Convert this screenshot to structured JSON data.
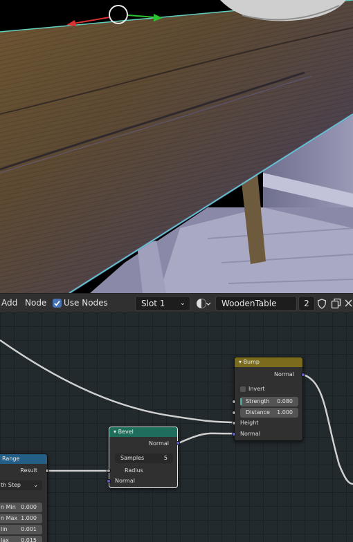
{
  "header": {
    "add_label": "Add",
    "node_label": "Node",
    "use_nodes_label": "Use Nodes",
    "slot_value": "Slot 1",
    "material_name": "WoodenTable",
    "user_count": "2"
  },
  "nodes": {
    "bump": {
      "title": "Bump",
      "output_normal": "Normal",
      "invert_label": "Invert",
      "strength_label": "Strength",
      "strength_value": "0.080",
      "distance_label": "Distance",
      "distance_value": "1.000",
      "input_height": "Height",
      "input_normal": "Normal"
    },
    "bevel": {
      "title": "Bevel",
      "output_normal": "Normal",
      "samples_label": "Samples",
      "samples_value": "5",
      "input_radius": "Radius",
      "input_normal": "Normal"
    },
    "map_range": {
      "title": "Range",
      "output_result": "Result",
      "interp_value": "th Step",
      "from_min_label": "n Min",
      "from_min_value": "0.000",
      "from_max_label": "n Max",
      "from_max_value": "1.000",
      "to_min_label": "lin",
      "to_min_value": "0.001",
      "to_max_label": "lax",
      "to_max_value": "0.015"
    }
  },
  "colors": {
    "bump_header": "#7a6b1d",
    "bevel_header": "#1f6e5c",
    "map_range_header": "#245e86",
    "selection_outline": "#5fd1c0",
    "gizmo_x": "#d83434",
    "gizmo_y": "#2ec12e",
    "vector_socket": "#6363c7",
    "float_socket": "#a1a1a1"
  }
}
